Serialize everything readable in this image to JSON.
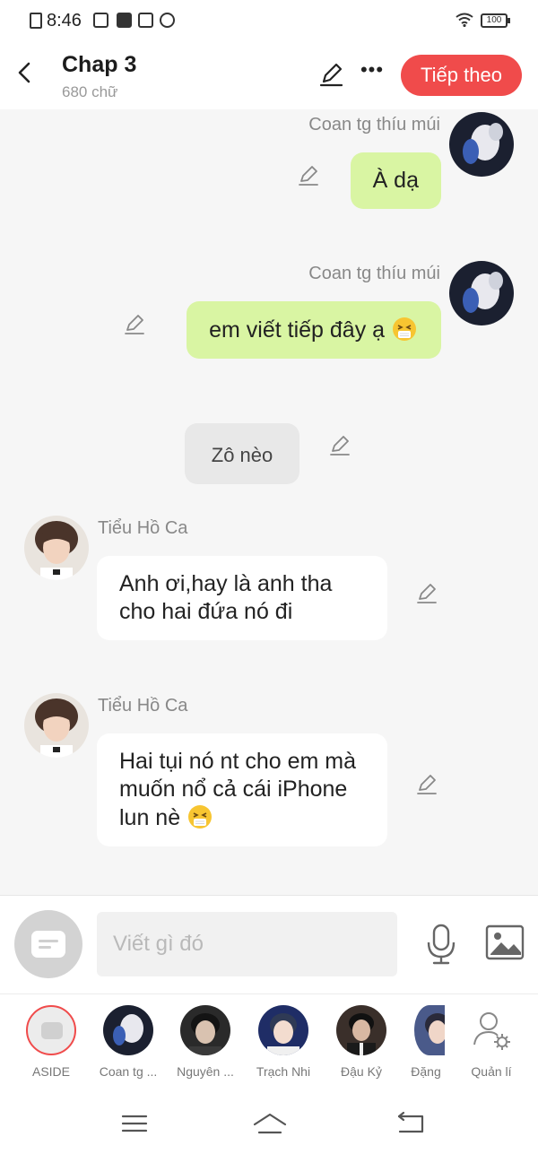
{
  "status": {
    "time": "8:46",
    "battery": "100"
  },
  "header": {
    "title": "Chap 3",
    "subtitle": "680 chữ",
    "next_label": "Tiếp theo"
  },
  "messages": [
    {
      "sender": "Coan tg thíu múi",
      "text": "À dạ"
    },
    {
      "sender": "Coan tg thíu múi",
      "text": "em viết tiếp đây ạ"
    },
    {
      "text": "Zô nèo"
    },
    {
      "sender": "Tiểu Hồ Ca",
      "text": "Anh ơi,hay là anh tha cho hai đứa nó đi"
    },
    {
      "sender": "Tiểu Hồ Ca",
      "text": "Hai tụi nó nt cho em mà muốn nổ cả cái iPhone lun nè"
    }
  ],
  "composer": {
    "placeholder": "Viết gì đó"
  },
  "characters": [
    {
      "label": "ASIDE"
    },
    {
      "label": "Coan tg ..."
    },
    {
      "label": "Nguyên ..."
    },
    {
      "label": "Trạch Nhi"
    },
    {
      "label": "Đậu Kỷ"
    },
    {
      "label": "Đặng"
    },
    {
      "label": "Quản lí"
    }
  ],
  "colors": {
    "accent": "#f04b4b",
    "own_bubble": "#d9f5a3",
    "other_bubble": "#ffffff",
    "narration_bubble": "#e8e8e8"
  },
  "icons": [
    "back-arrow-icon",
    "pencil-icon",
    "more-icon",
    "microphone-icon",
    "image-icon",
    "manage-user-icon",
    "menu-icon",
    "home-icon",
    "back-icon",
    "sneezing-face-emoji"
  ]
}
